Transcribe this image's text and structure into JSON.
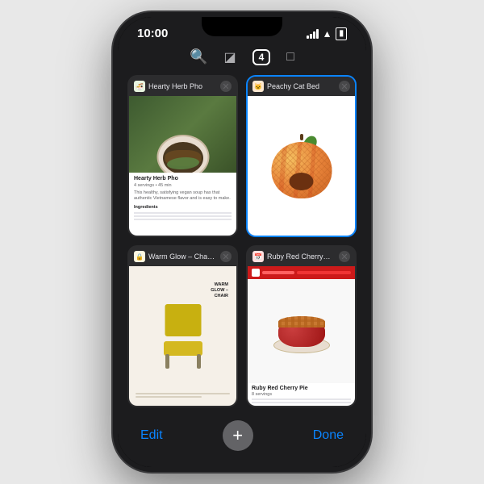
{
  "status_bar": {
    "time": "10:00"
  },
  "tab_bar": {
    "search_icon": "🔍",
    "tabs_icon": "⊞",
    "count": "4",
    "reader_icon": "⊡"
  },
  "tabs": [
    {
      "id": "hearty-herb-pho",
      "title": "Hearty Herb Pho",
      "favicon_color": "#6aad50",
      "active": false,
      "content_type": "pho"
    },
    {
      "id": "peachy-cat-bed",
      "title": "Peachy Cat Bed",
      "favicon_color": "#e8843a",
      "active": true,
      "content_type": "cat"
    },
    {
      "id": "warm-glow-chair",
      "title": "Warm Glow – Cha…",
      "favicon_color": "#d4b820",
      "active": false,
      "content_type": "chair"
    },
    {
      "id": "ruby-red-cherry",
      "title": "Ruby Red Cherry…",
      "favicon_color": "#cc1a1a",
      "active": false,
      "content_type": "cherry"
    }
  ],
  "bottom_bar": {
    "edit_label": "Edit",
    "add_icon": "+",
    "done_label": "Done"
  },
  "pho": {
    "title": "Hearty Herb Pho",
    "subtitle": "4 servings • 45 min",
    "description": "This healthy, satisfying vegan soup has that authentic Vietnamese flavor and is easy to make.",
    "ingredients_label": "Ingredients"
  },
  "chair": {
    "title": "WARM GLOW –\nCHAIR"
  },
  "cherry": {
    "title": "Ruby Red Cherry Pie",
    "subtitle": "8 servings"
  }
}
